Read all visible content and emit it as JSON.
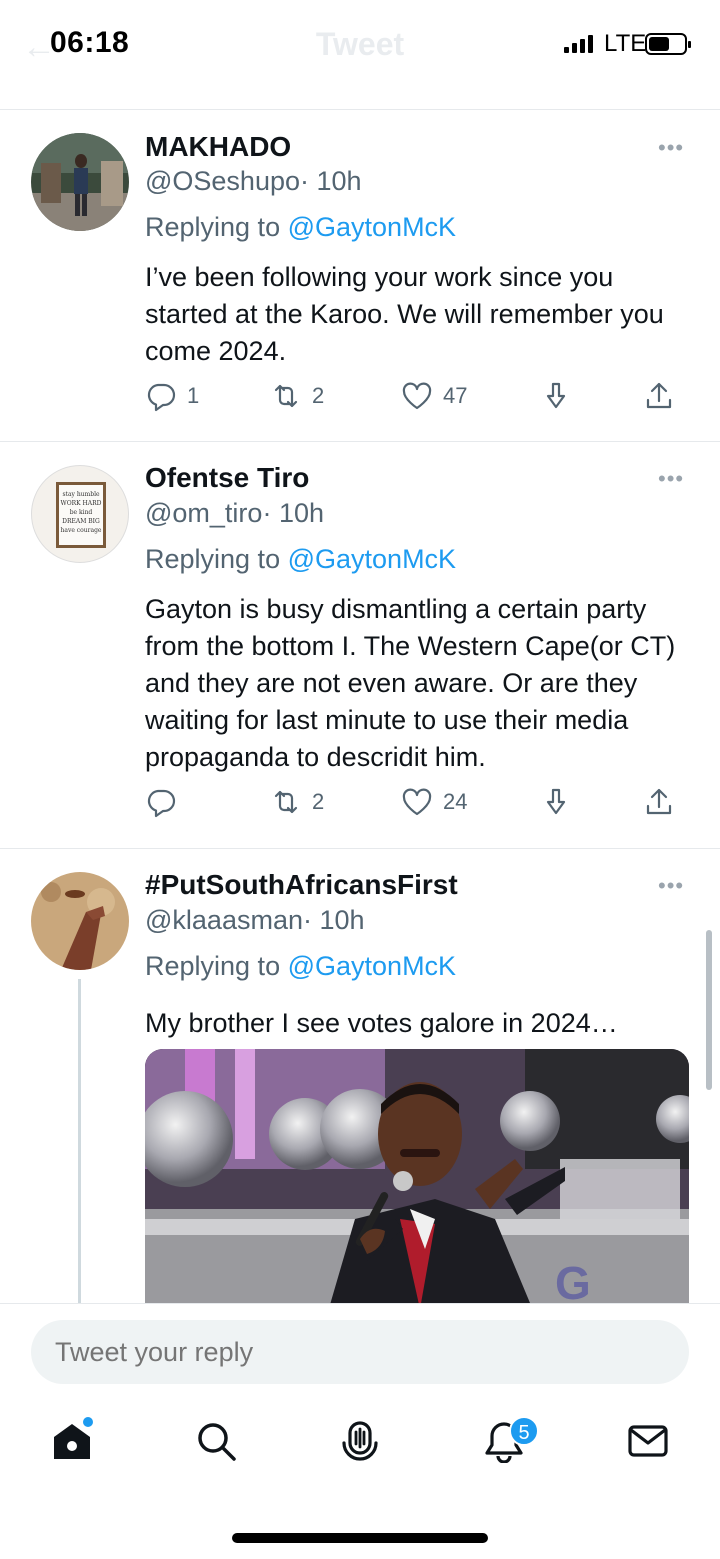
{
  "status_bar": {
    "time": "06:18",
    "network": "LTE",
    "ghost_title": "Tweet",
    "ghost_back_icon": "arrow-left-icon"
  },
  "tweets": [
    {
      "name": "MAKHADO",
      "handle": "@OSeshupo",
      "time": "· 10h",
      "replying_prefix": "Replying to",
      "replying_mention": "@GaytonMcK",
      "text": "I’ve been following your work since you started at the Karoo. We will remember you come 2024.",
      "replies": "1",
      "retweets": "2",
      "likes": "47"
    },
    {
      "name": "Ofentse Tiro",
      "handle": "@om_tiro",
      "time": "· 10h",
      "replying_prefix": "Replying to",
      "replying_mention": "@GaytonMcK",
      "text": "Gayton is busy dismantling a certain party from the bottom I. The Western Cape(or CT) and they are not even aware. Or are they waiting for last minute to use their media propaganda to descridit him.",
      "replies": "",
      "retweets": "2",
      "likes": "24",
      "avatar_text": [
        "stay humble",
        "WORK HARD",
        "be kind",
        "DREAM BIG",
        "have courage"
      ]
    },
    {
      "name": "#PutSouthAfricansFirst",
      "handle": "@klaaasman",
      "time": "· 10h",
      "replying_prefix": "Replying to",
      "replying_mention": "@GaytonMcK",
      "text": "My brother I see votes galore in 2024…",
      "media_letter": "G"
    }
  ],
  "reply_bar": {
    "placeholder": "Tweet your reply"
  },
  "tab_bar": {
    "items": [
      "home-icon",
      "search-icon",
      "spaces-icon",
      "notifications-icon",
      "messages-icon"
    ],
    "notifications_badge": "5"
  },
  "colors": {
    "accent": "#1d9bf0",
    "secondary_text": "#536471",
    "divider": "#e6e9ec"
  }
}
